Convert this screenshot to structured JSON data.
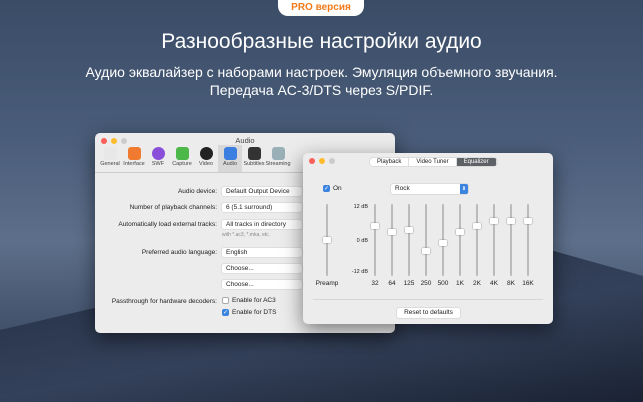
{
  "badge": "PRO версия",
  "headline": "Разнообразные настройки аудио",
  "subtitle_line1": "Аудио эквалайзер с наборами настроек. Эмуляция объемного звучания.",
  "subtitle_line2": "Передача AC-3/DTS через S/PDIF.",
  "audio_window": {
    "title": "Audio",
    "toolbar": [
      {
        "label": "General",
        "color": "#e8e8e8"
      },
      {
        "label": "Interface",
        "color": "#f07a30"
      },
      {
        "label": "SWF",
        "color": "#8a4fd8"
      },
      {
        "label": "Capture",
        "color": "#4cb84a"
      },
      {
        "label": "Video",
        "color": "#222222"
      },
      {
        "label": "Audio",
        "color": "#3b7fe0"
      },
      {
        "label": "Subtitles",
        "color": "#333333"
      },
      {
        "label": "Streaming",
        "color": "#9ab0b8"
      }
    ],
    "audio_device_label": "Audio device:",
    "audio_device": "Default Output Device",
    "channels_label": "Number of playback channels:",
    "channels": "6 (5.1 surround)",
    "external_label": "Automatically load external tracks:",
    "external": "All tracks in directory",
    "external_hint": "with *.ac3, *.mka, etc.",
    "language_label": "Preferred audio language:",
    "language": "English",
    "choose1": "Choose...",
    "choose2": "Choose...",
    "passthrough_label": "Passthrough for hardware decoders:",
    "ac3_label": "Enable for AC3",
    "ac3_checked": false,
    "dts_label": "Enable for DTS",
    "dts_checked": true
  },
  "eq_window": {
    "tabs": [
      "Playback",
      "Video Tuner",
      "Equalizer"
    ],
    "active_tab": "Equalizer",
    "on_label": "On",
    "on_checked": true,
    "preset": "Rock",
    "db_labels": [
      "12 dB",
      "0 dB",
      "-12 dB"
    ],
    "range_db": [
      -12,
      12
    ],
    "preamp": {
      "label": "Preamp",
      "value": 0
    },
    "bands": [
      {
        "label": "32",
        "value": 5
      },
      {
        "label": "64",
        "value": 3
      },
      {
        "label": "125",
        "value": 3.5
      },
      {
        "label": "250",
        "value": -4
      },
      {
        "label": "500",
        "value": -1
      },
      {
        "label": "1K",
        "value": 3
      },
      {
        "label": "2K",
        "value": 5
      },
      {
        "label": "4K",
        "value": 7
      },
      {
        "label": "8K",
        "value": 7
      },
      {
        "label": "16K",
        "value": 7
      }
    ],
    "reset_label": "Reset to defaults"
  }
}
